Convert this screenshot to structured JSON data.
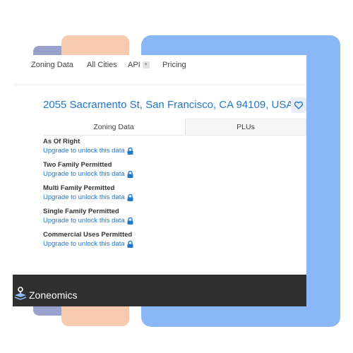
{
  "nav": {
    "zoning_data": "Zoning Data",
    "all_cities": "All Cities",
    "api": "API",
    "api_caret": "▾",
    "pricing": "Pricing"
  },
  "property": {
    "address": "2055 Sacramento St, San Francisco, CA 94109, USA"
  },
  "tabs": [
    {
      "label": "Zoning Data",
      "active": true
    },
    {
      "label": "PLUs",
      "active": false
    }
  ],
  "zoning_items": [
    {
      "title": "As Of Right",
      "link": "Upgrade to unlock this data"
    },
    {
      "title": "Two Family Permitted",
      "link": "Upgrade to unlock this data"
    },
    {
      "title": "Multi Family Permitted",
      "link": "Upgrade to unlock this data"
    },
    {
      "title": "Single Family Permitted",
      "link": "Upgrade to unlock this data"
    },
    {
      "title": "Commercial Uses Permitted",
      "link": "Upgrade to unlock this data"
    }
  ],
  "footer": {
    "brand": "Zoneomics"
  },
  "colors": {
    "accent": "#2477c9",
    "footer_bg": "#2f2f2f",
    "deco_blue": "#8ab8f7",
    "deco_peach": "#f7c9ae",
    "deco_purple": "#9aa0cc"
  },
  "icons": {
    "favorite": "heart-icon",
    "locked": "lock-icon",
    "brand": "layers-pin-logo"
  }
}
